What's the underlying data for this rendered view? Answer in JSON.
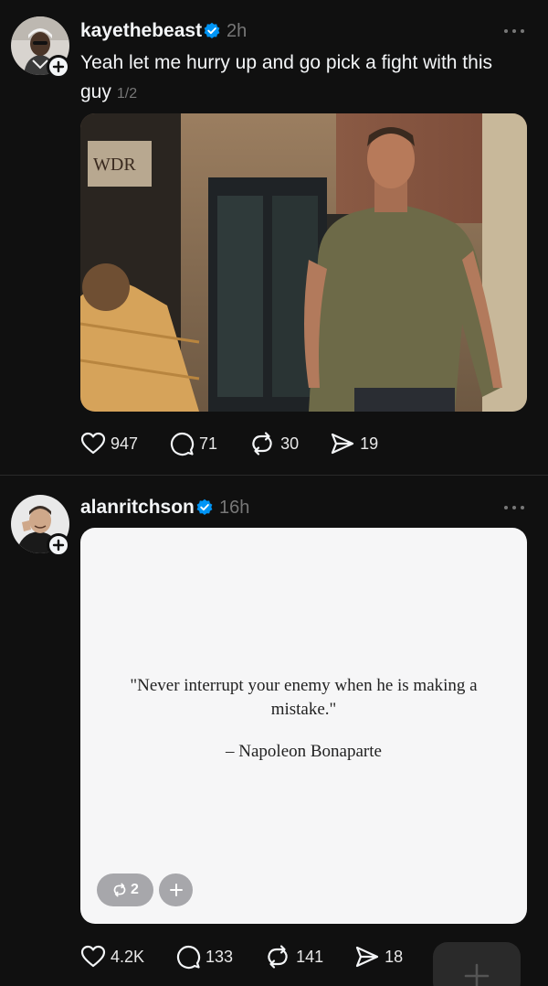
{
  "posts": [
    {
      "username": "kayethebeast",
      "time": "2h",
      "caption": "Yeah let me hurry up and go pick a fight with this guy",
      "page_indicator": "1/2",
      "media": {
        "type": "photo",
        "sign_text": "WDR"
      },
      "actions": {
        "likes": "947",
        "comments": "71",
        "reposts": "30",
        "shares": "19"
      }
    },
    {
      "username": "alanritchson",
      "time": "16h",
      "media": {
        "type": "quote-card",
        "quote": "\"Never interrupt your enemy when he is making a mistake.\"",
        "attribution": "– Napoleon Bonaparte",
        "repost_count": "2"
      },
      "actions": {
        "likes": "4.2K",
        "comments": "133",
        "reposts": "141",
        "shares": "18"
      }
    }
  ],
  "colors": {
    "background": "#101010",
    "text_primary": "#f3f5f7",
    "text_secondary": "#777777",
    "verified_blue": "#0095f6"
  },
  "icons": [
    "heart-icon",
    "comment-icon",
    "repost-icon",
    "share-icon",
    "verified-badge-icon",
    "more-icon",
    "plus-icon"
  ]
}
